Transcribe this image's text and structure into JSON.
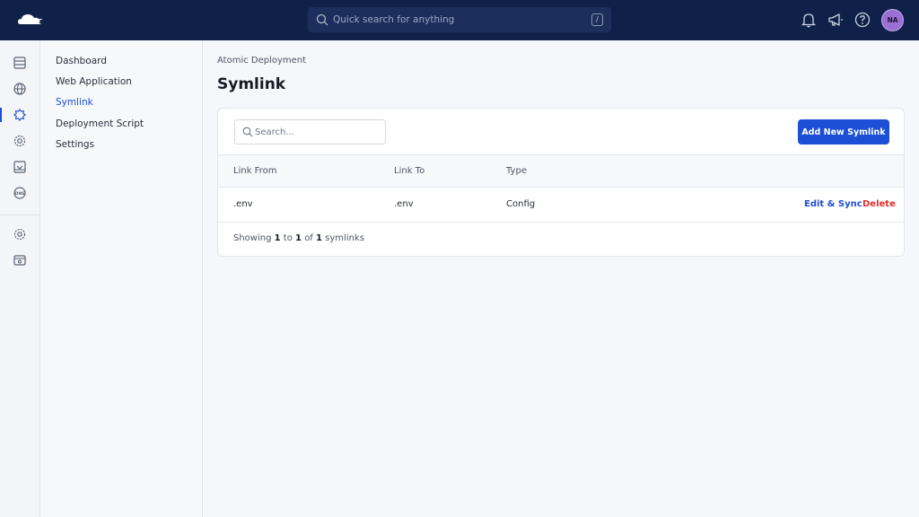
{
  "topbar": {
    "search_placeholder": "Quick search for anything",
    "shortcut_key": "/",
    "avatar_initials": "NA"
  },
  "colors": {
    "topbar_bg": "#0f2149",
    "accent": "#1c4fd6",
    "danger": "#e02d2d",
    "avatar": "#9b6fd3"
  },
  "rail": {
    "icons": [
      "server-icon",
      "globe-icon",
      "gear-star-icon",
      "cog-shield-icon",
      "download-box-icon",
      "dns-icon",
      "settings-icon",
      "billing-icon"
    ]
  },
  "subnav": {
    "items": [
      {
        "label": "Dashboard",
        "active": false
      },
      {
        "label": "Web Application",
        "active": false
      },
      {
        "label": "Symlink",
        "active": true
      },
      {
        "label": "Deployment Script",
        "active": false
      },
      {
        "label": "Settings",
        "active": false
      }
    ]
  },
  "main": {
    "breadcrumb": "Atomic Deployment",
    "title": "Symlink",
    "search_placeholder": "Search...",
    "add_button": "Add New Symlink",
    "columns": [
      "Link From",
      "Link To",
      "Type"
    ],
    "rows": [
      {
        "from": ".env",
        "to": ".env",
        "type": "Config",
        "edit_label": "Edit & Sync",
        "delete_label": "Delete"
      }
    ],
    "showing": {
      "prefix": "Showing",
      "from": "1",
      "to_word": "to",
      "to": "1",
      "of_word": "of",
      "total": "1",
      "suffix": "symlinks"
    }
  }
}
